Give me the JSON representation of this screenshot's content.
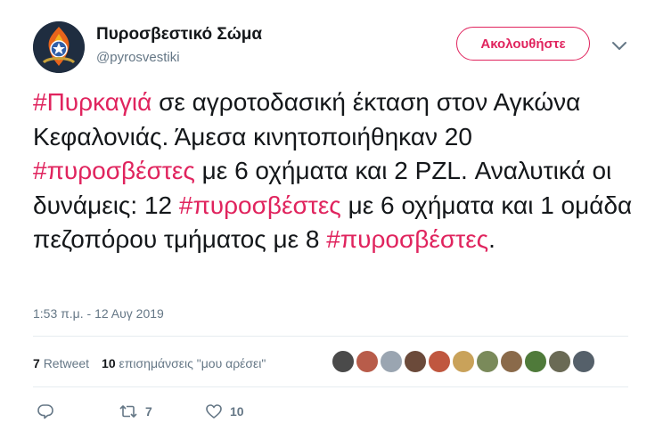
{
  "account": {
    "display_name": "Πυροσβεστικό Σώμα",
    "handle": "@pyrosvestiki",
    "avatar_icon": "fire-service-emblem-icon"
  },
  "follow_button": {
    "label": "Ακολουθήστε"
  },
  "tweet": {
    "segments": [
      {
        "text": "#Πυρκαγιά",
        "hashtag": true
      },
      {
        "text": " σε αγροτοδασική έκταση στον Αγκώνα Κεφαλονιάς. Άμεσα κινητοποιήθηκαν 20 ",
        "hashtag": false
      },
      {
        "text": "#πυροσβέστες",
        "hashtag": true
      },
      {
        "text": " με 6 οχήματα και 2 PZL. Αναλυτικά οι δυνάμεις: 12 ",
        "hashtag": false
      },
      {
        "text": "#πυροσβέστες",
        "hashtag": true
      },
      {
        "text": " με 6 οχήματα και 1 ομάδα πεζοπόρου τμήματος με 8 ",
        "hashtag": false
      },
      {
        "text": "#πυροσβέστες",
        "hashtag": true
      },
      {
        "text": ".",
        "hashtag": false
      }
    ],
    "timestamp": "1:53 π.μ. - 12 Αυγ 2019"
  },
  "stats": {
    "retweets_count": "7",
    "retweets_label": "Retweet",
    "likes_count": "10",
    "likes_label": "επισημάνσεις \"μου αρέσει\""
  },
  "likers": [
    {
      "icon": "user-avatar-icon",
      "color": "#4a4a4a"
    },
    {
      "icon": "user-avatar-icon",
      "color": "#b85c4a"
    },
    {
      "icon": "default-avatar-icon",
      "color": "#9aa5b1"
    },
    {
      "icon": "user-avatar-icon",
      "color": "#6b4a3a"
    },
    {
      "icon": "user-avatar-icon",
      "color": "#c0573f"
    },
    {
      "icon": "user-avatar-icon",
      "color": "#c9a25a"
    },
    {
      "icon": "user-avatar-icon",
      "color": "#7a8a5a"
    },
    {
      "icon": "user-avatar-icon",
      "color": "#8a6a4a"
    },
    {
      "icon": "user-avatar-icon",
      "color": "#4f7a3a"
    },
    {
      "icon": "user-avatar-icon",
      "color": "#6a6a55"
    },
    {
      "icon": "user-avatar-icon",
      "color": "#55606a"
    }
  ],
  "actions": {
    "retweet_count": "7",
    "like_count": "10"
  },
  "colors": {
    "accent": "#e0245e",
    "muted": "#657786",
    "text": "#14171a"
  }
}
